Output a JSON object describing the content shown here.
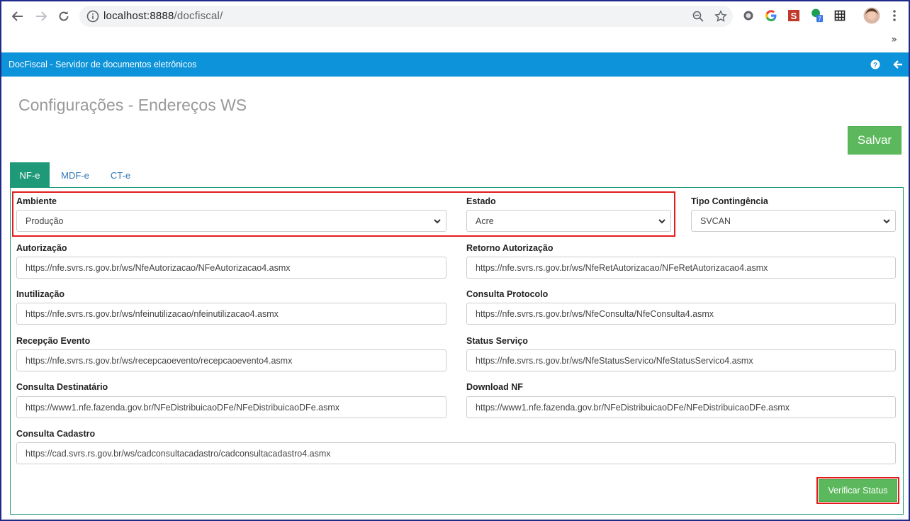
{
  "browser": {
    "url_host": "localhost:8888",
    "url_path": "/docfiscal/",
    "extension_badge": "7",
    "more_bookmarks": "»"
  },
  "app": {
    "title": "DocFiscal - Servidor de documentos eletrônicos"
  },
  "page": {
    "title": "Configurações - Endereços WS",
    "save_label": "Salvar"
  },
  "tabs": [
    {
      "label": "NF-e",
      "active": true
    },
    {
      "label": "MDF-e",
      "active": false
    },
    {
      "label": "CT-e",
      "active": false
    }
  ],
  "form": {
    "ambiente": {
      "label": "Ambiente",
      "value": "Produção"
    },
    "estado": {
      "label": "Estado",
      "value": "Acre"
    },
    "tipo_contingencia": {
      "label": "Tipo Contingência",
      "value": "SVCAN"
    },
    "autorizacao": {
      "label": "Autorização",
      "value": "https://nfe.svrs.rs.gov.br/ws/NfeAutorizacao/NFeAutorizacao4.asmx"
    },
    "retorno_autorizacao": {
      "label": "Retorno Autorização",
      "value": "https://nfe.svrs.rs.gov.br/ws/NfeRetAutorizacao/NFeRetAutorizacao4.asmx"
    },
    "inutilizacao": {
      "label": "Inutilização",
      "value": "https://nfe.svrs.rs.gov.br/ws/nfeinutilizacao/nfeinutilizacao4.asmx"
    },
    "consulta_protocolo": {
      "label": "Consulta Protocolo",
      "value": "https://nfe.svrs.rs.gov.br/ws/NfeConsulta/NfeConsulta4.asmx"
    },
    "recepcao_evento": {
      "label": "Recepção Evento",
      "value": "https://nfe.svrs.rs.gov.br/ws/recepcaoevento/recepcaoevento4.asmx"
    },
    "status_servico": {
      "label": "Status Serviço",
      "value": "https://nfe.svrs.rs.gov.br/ws/NfeStatusServico/NfeStatusServico4.asmx"
    },
    "consulta_destinatario": {
      "label": "Consulta Destinatário",
      "value": "https://www1.nfe.fazenda.gov.br/NFeDistribuicaoDFe/NFeDistribuicaoDFe.asmx"
    },
    "download_nf": {
      "label": "Download NF",
      "value": "https://www1.nfe.fazenda.gov.br/NFeDistribuicaoDFe/NFeDistribuicaoDFe.asmx"
    },
    "consulta_cadastro": {
      "label": "Consulta Cadastro",
      "value": "https://cad.svrs.rs.gov.br/ws/cadconsultacadastro/cadconsultacadastro4.asmx"
    }
  },
  "actions": {
    "verify_label": "Verificar Status"
  },
  "colors": {
    "header_bg": "#0d93d9",
    "tab_active": "#1f9a78",
    "button_green": "#5cb85c",
    "highlight_red": "#e21b1b"
  }
}
